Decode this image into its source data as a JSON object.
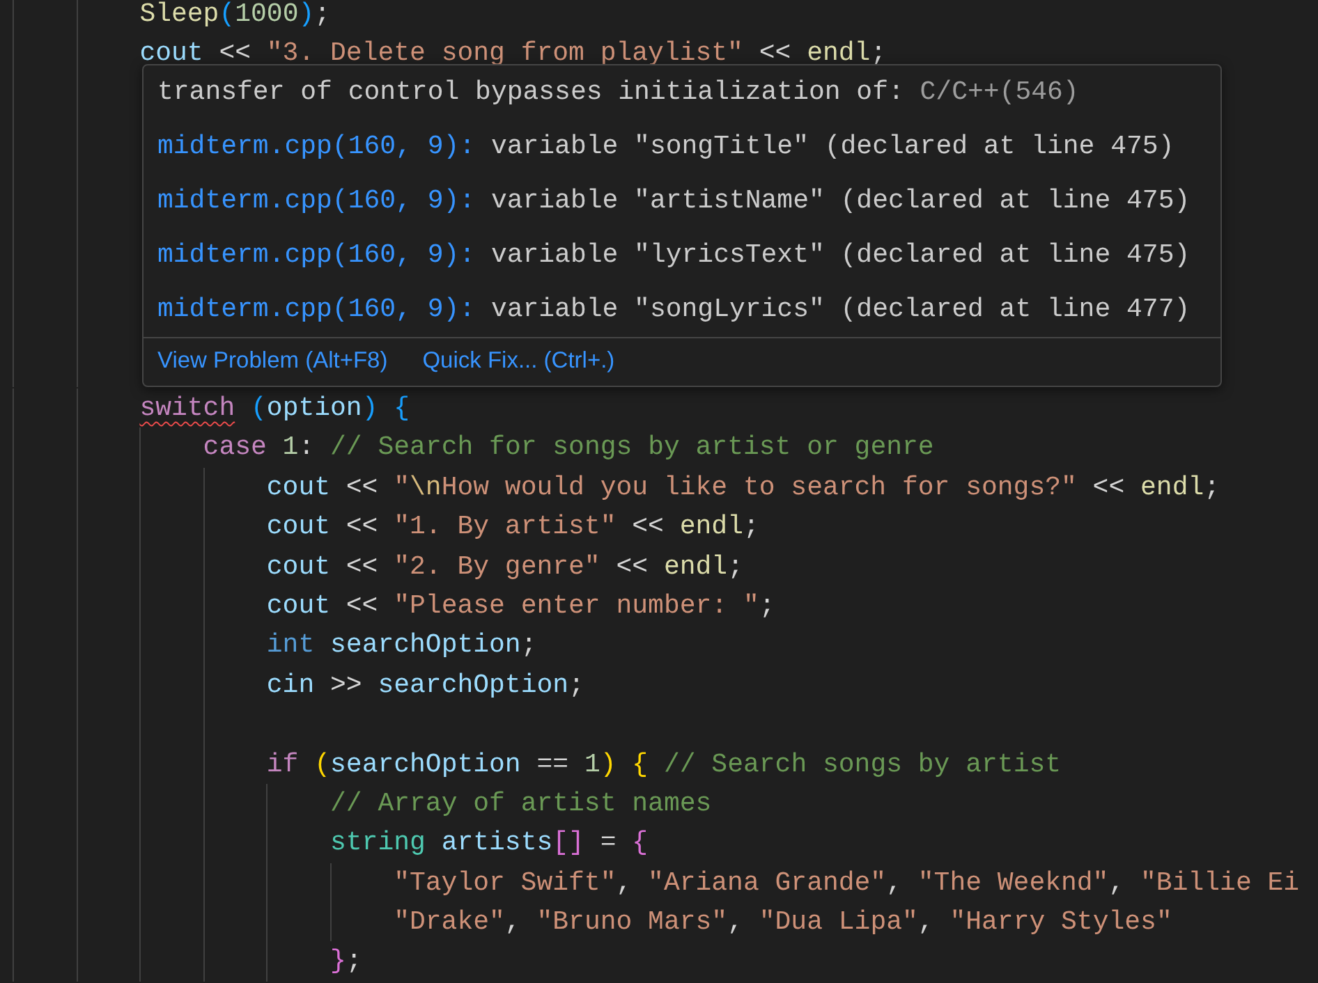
{
  "editor": {
    "lines_before": [
      {
        "tokens": [
          {
            "kind": "func",
            "text": "Sleep"
          },
          {
            "kind": "bracket3",
            "text": "("
          },
          {
            "kind": "num",
            "text": "1000"
          },
          {
            "kind": "bracket3",
            "text": ")"
          },
          {
            "kind": "op",
            "text": ";"
          }
        ]
      },
      {
        "tokens": [
          {
            "kind": "var",
            "text": "cout"
          },
          {
            "kind": "op",
            "text": " << "
          },
          {
            "kind": "str",
            "text": "\"3. Delete song from playlist\""
          },
          {
            "kind": "op",
            "text": " << "
          },
          {
            "kind": "func",
            "text": "endl"
          },
          {
            "kind": "op",
            "text": ";"
          }
        ]
      }
    ],
    "hover": {
      "message": "transfer of control bypasses initialization of:",
      "source": "C/C++(546)",
      "related": [
        {
          "location": "midterm.cpp(160, 9):",
          "text": "variable \"songTitle\" (declared at line 475)"
        },
        {
          "location": "midterm.cpp(160, 9):",
          "text": "variable \"artistName\" (declared at line 475)"
        },
        {
          "location": "midterm.cpp(160, 9):",
          "text": "variable \"lyricsText\" (declared at line 475)"
        },
        {
          "location": "midterm.cpp(160, 9):",
          "text": "variable \"songLyrics\" (declared at line 477)"
        }
      ],
      "actions": [
        "View Problem (Alt+F8)",
        "Quick Fix... (Ctrl+.)"
      ]
    },
    "lines_after": [
      {
        "tokens": [
          {
            "kind": "flagged",
            "text": "switch"
          },
          {
            "kind": "bracket3",
            "text": " ("
          },
          {
            "kind": "var",
            "text": "option"
          },
          {
            "kind": "bracket3",
            "text": ") {"
          }
        ],
        "children": [
          {
            "tokens": [
              {
                "kind": "keyword",
                "text": "case"
              },
              {
                "kind": "num",
                "text": " 1"
              },
              {
                "kind": "op",
                "text": ": "
              },
              {
                "kind": "comment",
                "text": "// Search for songs by artist or genre"
              }
            ],
            "children": [
              {
                "blank_line_before": false,
                "tokens": [
                  {
                    "kind": "var",
                    "text": "cout"
                  },
                  {
                    "kind": "op",
                    "text": " << "
                  },
                  {
                    "kind": "str",
                    "text": "\""
                  },
                  {
                    "kind": "escape",
                    "text": "\\n"
                  },
                  {
                    "kind": "str",
                    "text": "How would you like to search for songs?\""
                  },
                  {
                    "kind": "op",
                    "text": " << "
                  },
                  {
                    "kind": "func",
                    "text": "endl"
                  },
                  {
                    "kind": "op",
                    "text": ";"
                  }
                ]
              },
              {
                "blank_line_before": false,
                "tokens": [
                  {
                    "kind": "var",
                    "text": "cout"
                  },
                  {
                    "kind": "op",
                    "text": " << "
                  },
                  {
                    "kind": "str",
                    "text": "\"1. By artist\""
                  },
                  {
                    "kind": "op",
                    "text": " << "
                  },
                  {
                    "kind": "func",
                    "text": "endl"
                  },
                  {
                    "kind": "op",
                    "text": ";"
                  }
                ]
              },
              {
                "blank_line_before": false,
                "tokens": [
                  {
                    "kind": "var",
                    "text": "cout"
                  },
                  {
                    "kind": "op",
                    "text": " << "
                  },
                  {
                    "kind": "str",
                    "text": "\"2. By genre\""
                  },
                  {
                    "kind": "op",
                    "text": " << "
                  },
                  {
                    "kind": "func",
                    "text": "endl"
                  },
                  {
                    "kind": "op",
                    "text": ";"
                  }
                ]
              },
              {
                "blank_line_before": false,
                "tokens": [
                  {
                    "kind": "var",
                    "text": "cout"
                  },
                  {
                    "kind": "op",
                    "text": " << "
                  },
                  {
                    "kind": "str",
                    "text": "\"Please enter number: \""
                  },
                  {
                    "kind": "op",
                    "text": ";"
                  }
                ]
              },
              {
                "blank_line_before": false,
                "tokens": [
                  {
                    "kind": "type",
                    "text": "int"
                  },
                  {
                    "kind": "var",
                    "text": " searchOption"
                  },
                  {
                    "kind": "op",
                    "text": ";"
                  }
                ]
              },
              {
                "blank_line_before": false,
                "tokens": [
                  {
                    "kind": "var",
                    "text": "cin"
                  },
                  {
                    "kind": "op",
                    "text": " >> "
                  },
                  {
                    "kind": "var",
                    "text": "searchOption"
                  },
                  {
                    "kind": "op",
                    "text": ";"
                  }
                ]
              },
              {
                "blank_line_before": true,
                "tokens": [
                  {
                    "kind": "keyword",
                    "text": "if"
                  },
                  {
                    "kind": "bracket1",
                    "text": " ("
                  },
                  {
                    "kind": "var",
                    "text": "searchOption"
                  },
                  {
                    "kind": "op",
                    "text": " == "
                  },
                  {
                    "kind": "num",
                    "text": "1"
                  },
                  {
                    "kind": "bracket1",
                    "text": ") {"
                  },
                  {
                    "kind": "comment",
                    "text": " // Search songs by artist"
                  }
                ],
                "children": [
                  {
                    "tokens": [
                      {
                        "kind": "comment",
                        "text": "// Array of artist names"
                      }
                    ]
                  },
                  {
                    "tokens": [
                      {
                        "kind": "class",
                        "text": "string"
                      },
                      {
                        "kind": "var",
                        "text": " artists"
                      },
                      {
                        "kind": "bracket2",
                        "text": "[]"
                      },
                      {
                        "kind": "op",
                        "text": " = "
                      },
                      {
                        "kind": "bracket2",
                        "text": "{"
                      }
                    ],
                    "children": [
                      {
                        "tokens": [
                          {
                            "kind": "str",
                            "text": "\"Taylor Swift\""
                          },
                          {
                            "kind": "op",
                            "text": ", "
                          },
                          {
                            "kind": "str",
                            "text": "\"Ariana Grande\""
                          },
                          {
                            "kind": "op",
                            "text": ", "
                          },
                          {
                            "kind": "str",
                            "text": "\"The Weeknd\""
                          },
                          {
                            "kind": "op",
                            "text": ", "
                          },
                          {
                            "kind": "str",
                            "text": "\"Billie Ei"
                          }
                        ]
                      },
                      {
                        "tokens": [
                          {
                            "kind": "str",
                            "text": "\"Drake\""
                          },
                          {
                            "kind": "op",
                            "text": ", "
                          },
                          {
                            "kind": "str",
                            "text": "\"Bruno Mars\""
                          },
                          {
                            "kind": "op",
                            "text": ", "
                          },
                          {
                            "kind": "str",
                            "text": "\"Dua Lipa\""
                          },
                          {
                            "kind": "op",
                            "text": ", "
                          },
                          {
                            "kind": "str",
                            "text": "\"Harry Styles\""
                          }
                        ]
                      }
                    ]
                  },
                  {
                    "tokens": [
                      {
                        "kind": "bracket2",
                        "text": "}"
                      },
                      {
                        "kind": "op",
                        "text": ";"
                      }
                    ]
                  }
                ]
              }
            ]
          }
        ]
      }
    ]
  }
}
